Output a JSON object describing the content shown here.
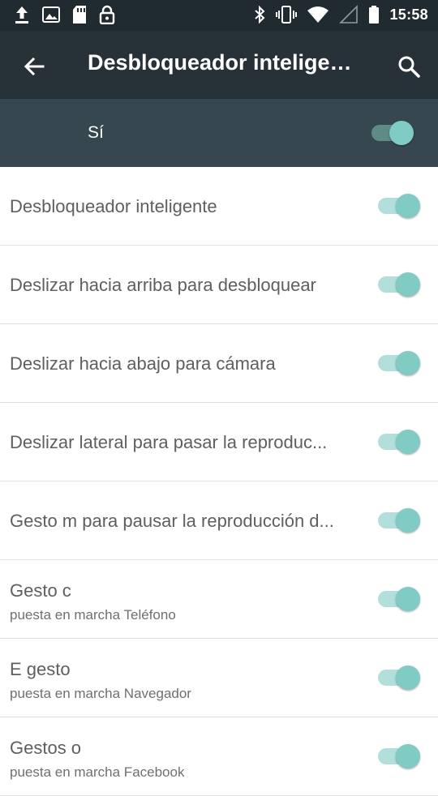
{
  "status_bar": {
    "time": "15:58",
    "left_icons": [
      "upload-icon",
      "image-icon",
      "sd-card-icon",
      "lock-icon"
    ],
    "right_icons": [
      "bluetooth-icon",
      "vibrate-icon",
      "wifi-icon",
      "signal-icon",
      "battery-icon"
    ]
  },
  "app_bar": {
    "title": "Desbloqueador intelige…",
    "back_icon": "arrow-back-icon",
    "search_icon": "search-icon"
  },
  "master_switch": {
    "label": "Sí",
    "on": true
  },
  "settings": [
    {
      "title": "Desbloqueador inteligente",
      "subtitle": "",
      "on": true
    },
    {
      "title": "Deslizar hacia arriba para desbloquear",
      "subtitle": "",
      "on": true
    },
    {
      "title": "Deslizar hacia abajo para cámara",
      "subtitle": "",
      "on": true
    },
    {
      "title": " Deslizar lateral para pasar la reproduc...",
      "subtitle": "",
      "on": true
    },
    {
      "title": "Gesto m para pausar la reproducción d...",
      "subtitle": "",
      "on": true
    },
    {
      "title": "Gesto c",
      "subtitle": "puesta en marcha Teléfono",
      "on": true
    },
    {
      "title": "E gesto",
      "subtitle": "puesta en marcha Navegador",
      "on": true
    },
    {
      "title": "Gestos o",
      "subtitle": "puesta en marcha Facebook",
      "on": true
    }
  ],
  "colors": {
    "status_bar": "#1f2b31",
    "app_bar": "#263238",
    "master_bar": "#37474f",
    "switch_thumb_on": "#80cbc4",
    "switch_track_on": "#b2dfdb",
    "master_track_on": "#5f8a86"
  }
}
